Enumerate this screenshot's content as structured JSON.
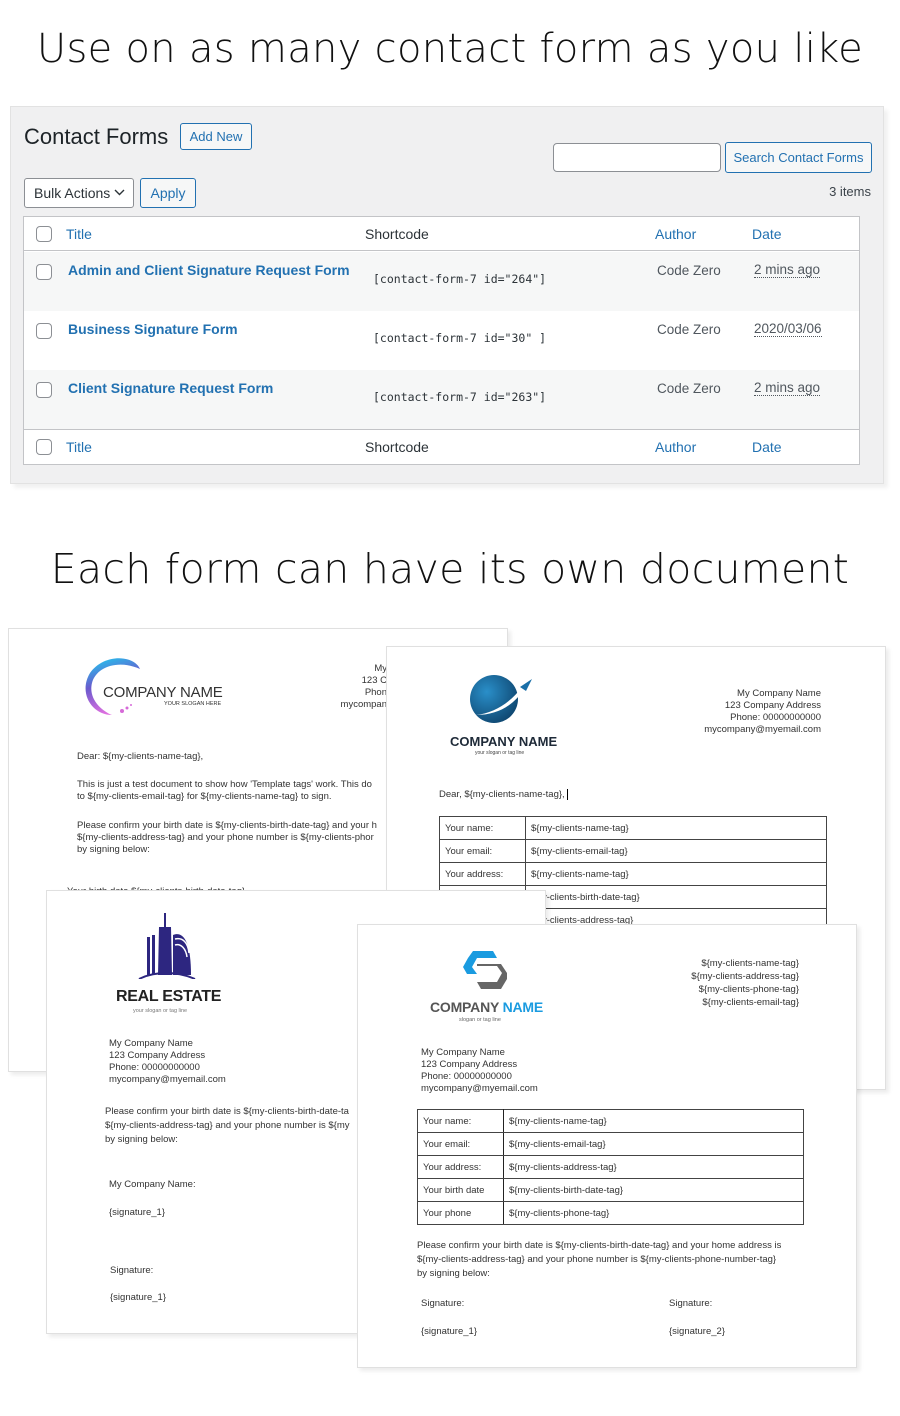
{
  "headings": {
    "top": "Use on as many contact form as you like",
    "middle": "Each form can have its own document"
  },
  "wp": {
    "page_title": "Contact Forms",
    "add_new_label": "Add New",
    "search": {
      "value": "",
      "placeholder": "",
      "button_label": "Search Contact Forms"
    },
    "bulk_actions": {
      "selected": "Bulk Actions",
      "icon": "chevron-down-icon"
    },
    "apply_label": "Apply",
    "items_count": "3 items",
    "columns": [
      "Title",
      "Shortcode",
      "Author",
      "Date"
    ],
    "rows": [
      {
        "title": "Admin and Client Signature Request Form",
        "shortcode": "[contact-form-7 id=\"264\"]",
        "author": "Code Zero",
        "date": "2 mins ago"
      },
      {
        "title": "Business Signature Form",
        "shortcode": "[contact-form-7 id=\"30\" ]",
        "author": "Code Zero",
        "date": "2020/03/06"
      },
      {
        "title": "Client Signature Request Form",
        "shortcode": "[contact-form-7 id=\"263\"]",
        "author": "Code Zero",
        "date": "2 mins ago"
      }
    ],
    "colors": {
      "link": "#2271b1",
      "panel_bg": "#f0f0f1",
      "alt_row": "#f6f7f7"
    }
  },
  "documents": [
    {
      "logo": {
        "name": "COMPANY NAME",
        "slogan": "YOUR SLOGAN HERE",
        "icon": "swirl-c-logo-icon"
      },
      "address": [
        "My",
        "123 C",
        "Phon",
        "mycompan"
      ],
      "greeting": "Dear: ${my-clients-name-tag},",
      "para1": [
        "This is just a test document to show how 'Template tags' work. This do",
        "to ${my-clients-email-tag} for ${my-clients-name-tag} to sign."
      ],
      "para2": [
        "Please confirm your birth date is ${my-clients-birth-date-tag} and your h",
        "${my-clients-address-tag} and your phone number is ${my-clients-phor",
        "by signing below:"
      ],
      "partial_row": "Your birth date     ${my-clients-birth-date-tag}"
    },
    {
      "logo": {
        "name": "COMPANY NAME",
        "slogan": "your slogan or tag line",
        "icon": "globe-plane-logo-icon"
      },
      "address": [
        "My Company Name",
        "123 Company Address",
        "Phone: 00000000000",
        "mycompany@myemail.com"
      ],
      "greeting": "Dear, ${my-clients-name-tag},",
      "table": [
        [
          "Your name:",
          "${my-clients-name-tag}"
        ],
        [
          "Your email:",
          "${my-clients-email-tag}"
        ],
        [
          "Your address:",
          "${my-clients-name-tag}"
        ],
        [
          "",
          "y-clients-birth-date-tag}"
        ],
        [
          "",
          "y-clients-address-tag}"
        ]
      ]
    },
    {
      "logo": {
        "name": "REAL ESTATE",
        "slogan": "your slogan or tag line",
        "icon": "building-logo-icon"
      },
      "address": [
        "My Company Name",
        "123 Company Address",
        "Phone: 00000000000",
        "mycompany@myemail.com"
      ],
      "para": [
        "Please confirm your birth date is ${my-clients-birth-date-ta",
        "${my-clients-address-tag} and your phone number is ${my",
        "by signing below:"
      ],
      "sig_block1": {
        "label": "My Company Name:",
        "value": "{signature_1}"
      },
      "sig_block2": {
        "label": "Signature:",
        "value": "{signature_1}"
      }
    },
    {
      "logo": {
        "name_part1": "COMPANY",
        "name_part2": "NAME",
        "slogan": "slogan or tag line",
        "icon": "hexagon-s-logo-icon"
      },
      "client_tags": [
        "${my-clients-name-tag}",
        "${my-clients-address-tag}",
        "${my-clients-phone-tag}",
        "${my-clients-email-tag}"
      ],
      "address": [
        "My Company Name",
        "123 Company Address",
        "Phone: 00000000000",
        "mycompany@myemail.com"
      ],
      "table": [
        [
          "Your name:",
          "${my-clients-name-tag}"
        ],
        [
          "Your email:",
          "${my-clients-email-tag}"
        ],
        [
          "Your address:",
          "${my-clients-address-tag}"
        ],
        [
          "Your birth date",
          "${my-clients-birth-date-tag}"
        ],
        [
          "Your phone",
          "${my-clients-phone-tag}"
        ]
      ],
      "para": [
        "Please confirm your birth date is ${my-clients-birth-date-tag} and your home address is",
        "${my-clients-address-tag} and your phone number is ${my-clients-phone-number-tag}",
        "by signing below:"
      ],
      "signatures": [
        {
          "label": "Signature:",
          "value": "{signature_1}"
        },
        {
          "label": "Signature:",
          "value": "{signature_2}"
        }
      ]
    }
  ]
}
